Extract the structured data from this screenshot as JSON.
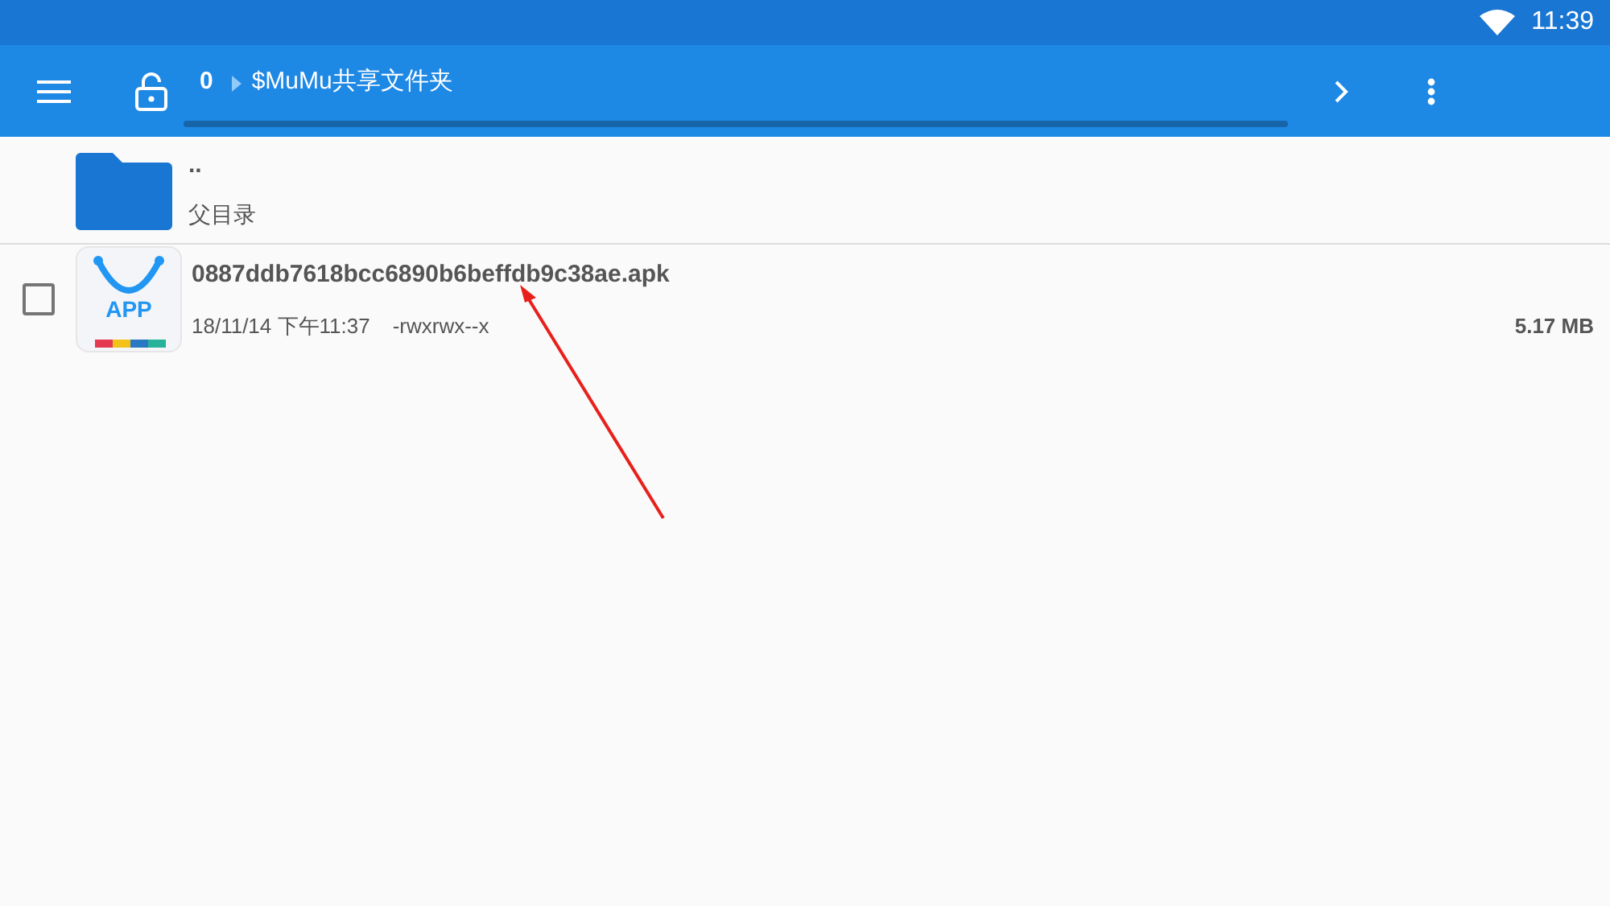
{
  "status_bar": {
    "time": "11:39"
  },
  "toolbar": {
    "path": [
      {
        "label": "0"
      },
      {
        "label": "$MuMu共享文件夹"
      }
    ]
  },
  "entries": [
    {
      "kind": "folder",
      "name": "..",
      "detail": "父目录"
    },
    {
      "kind": "apk",
      "icon_label": "APP",
      "name": "0887ddb7618bcc6890b6beffdb9c38ae.apk",
      "date": "18/11/14 下午11:37",
      "permissions": "-rwxrwx--x",
      "size": "5.17 MB",
      "checked": false
    }
  ]
}
